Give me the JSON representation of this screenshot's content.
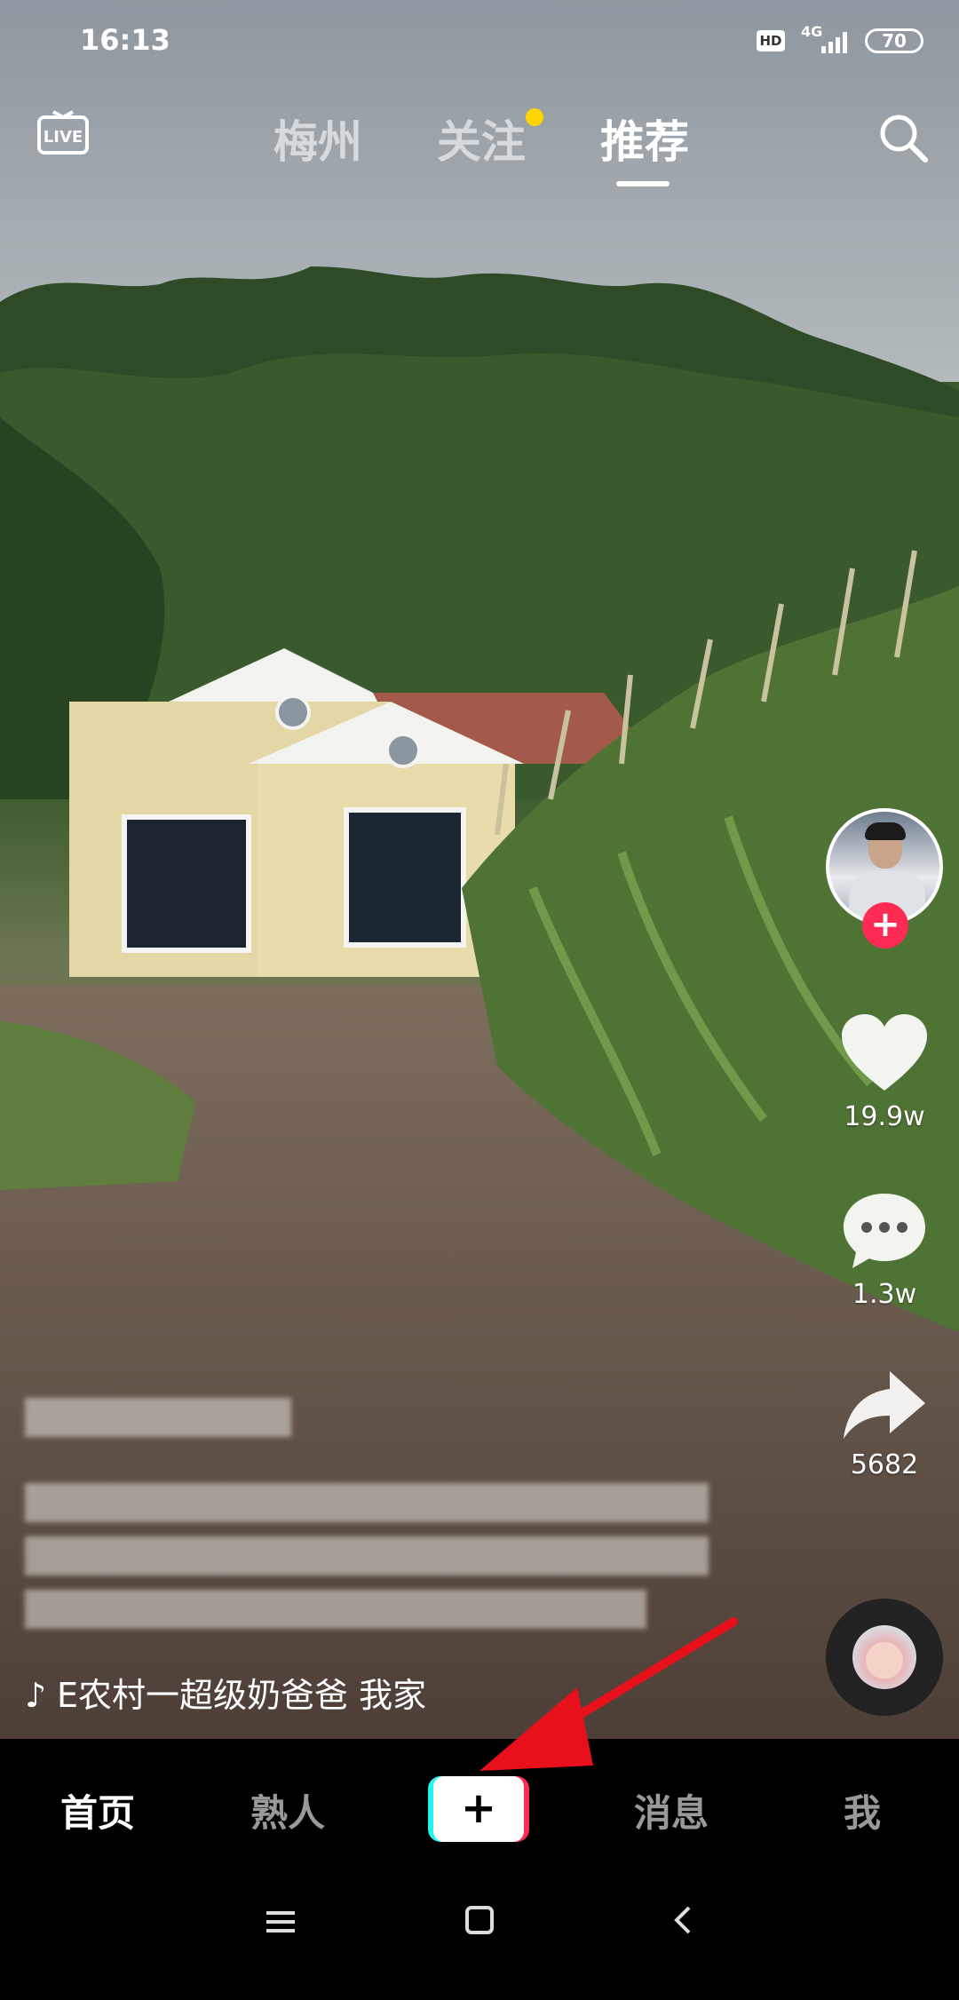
{
  "status_bar": {
    "time": "16:13",
    "hd_badge": "HD",
    "network": "4G",
    "battery": "70"
  },
  "top_nav": {
    "live_label": "LIVE",
    "tabs": [
      {
        "label": "梅州"
      },
      {
        "label": "关注"
      },
      {
        "label": "推荐"
      }
    ],
    "active_tab": "推荐",
    "follow_dot_color": "#ffd400"
  },
  "video": {
    "likes": "19.9w",
    "comments": "1.3w",
    "shares": "5682",
    "music_text": "E农村一超级奶爸爸   我家"
  },
  "bottom_nav": {
    "home": "首页",
    "friends": "熟人",
    "create": "+",
    "messages": "消息",
    "me": "我"
  },
  "colors": {
    "accent_red": "#fe2c55",
    "accent_cyan": "#25f4ee",
    "annotation_arrow": "#e8101a"
  }
}
